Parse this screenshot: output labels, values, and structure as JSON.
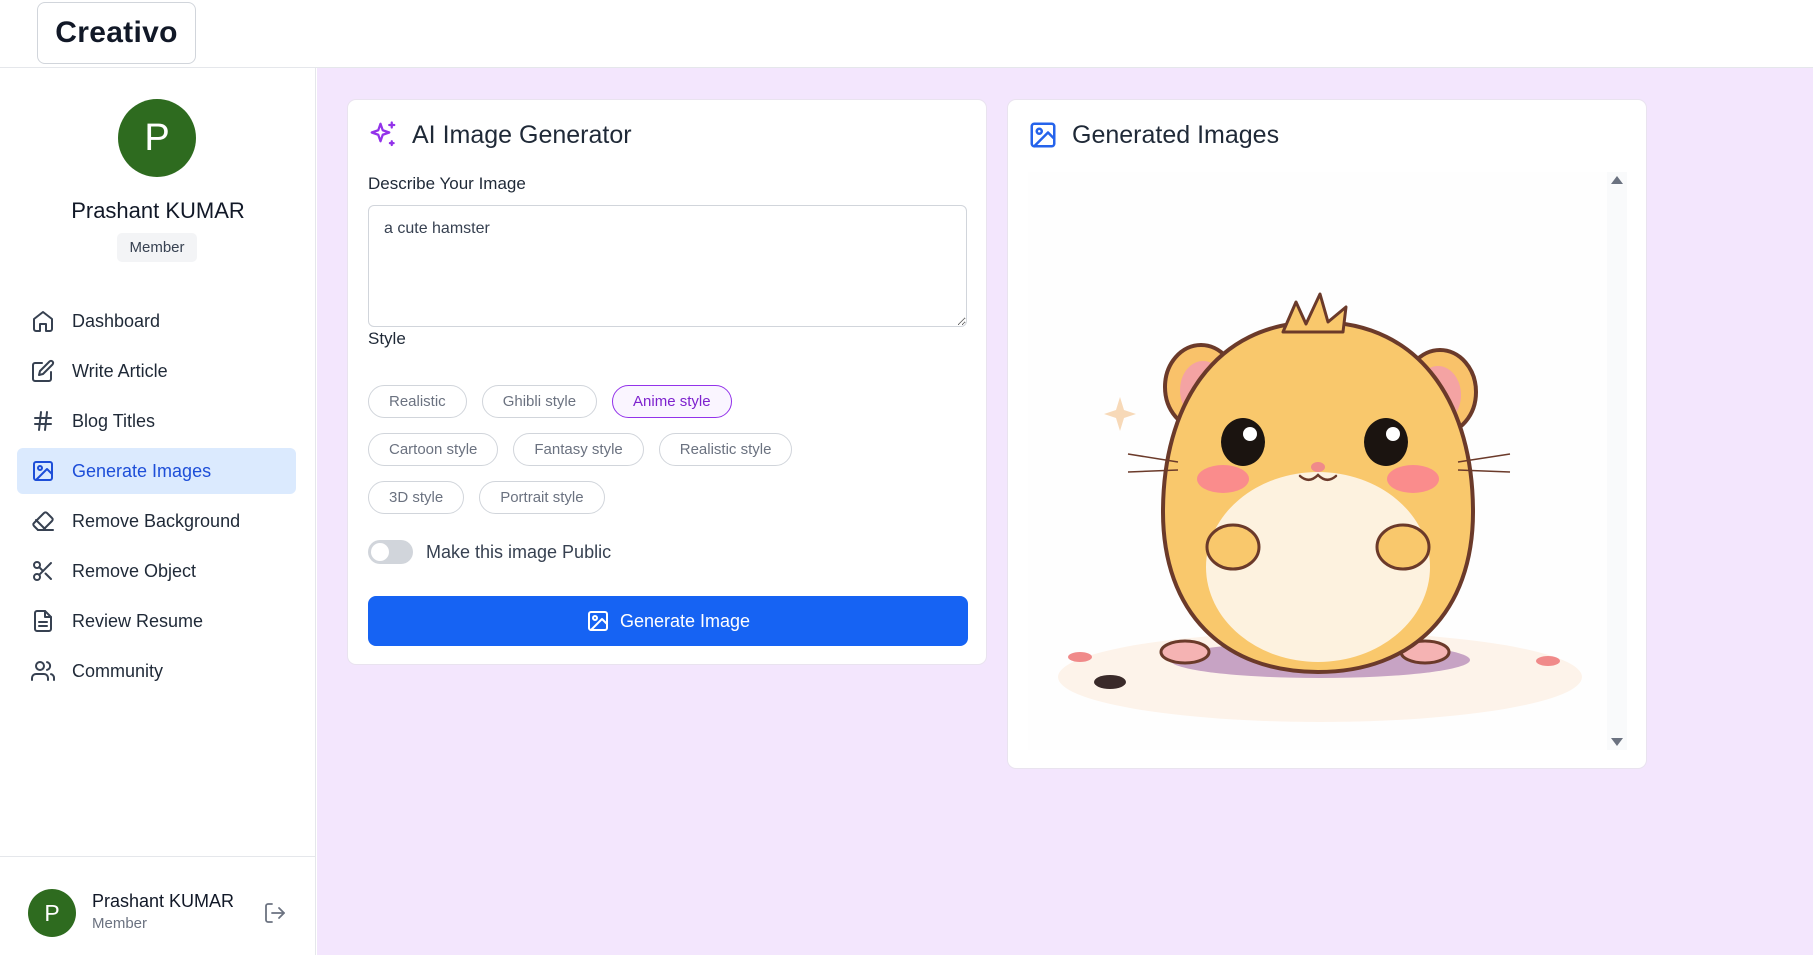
{
  "app": {
    "logo": "Creativo"
  },
  "user": {
    "initial": "P",
    "name": "Prashant KUMAR",
    "role": "Member"
  },
  "sidebar": {
    "items": [
      {
        "label": "Dashboard",
        "icon": "home-icon"
      },
      {
        "label": "Write Article",
        "icon": "edit-icon"
      },
      {
        "label": "Blog Titles",
        "icon": "hash-icon"
      },
      {
        "label": "Generate Images",
        "icon": "image-icon",
        "active": true
      },
      {
        "label": "Remove Background",
        "icon": "eraser-icon"
      },
      {
        "label": "Remove Object",
        "icon": "scissors-icon"
      },
      {
        "label": "Review Resume",
        "icon": "file-text-icon"
      },
      {
        "label": "Community",
        "icon": "users-icon"
      }
    ]
  },
  "generator": {
    "title": "AI Image Generator",
    "prompt_label": "Describe Your Image",
    "prompt_value": "a cute hamster",
    "style_label": "Style",
    "styles": [
      "Realistic",
      "Ghibli style",
      "Anime style",
      "Cartoon style",
      "Fantasy style",
      "Realistic style",
      "3D style",
      "Portrait style"
    ],
    "selected_style": "Anime style",
    "public_label": "Make this image Public",
    "public_enabled": false,
    "button_label": "Generate Image"
  },
  "results": {
    "title": "Generated Images",
    "image": "cute-anime-hamster-illustration"
  },
  "colors": {
    "accent_blue": "#1663f3",
    "selected_purple": "#9333ea",
    "avatar_green": "#2e6b1f",
    "background": "#f3e6fd"
  }
}
